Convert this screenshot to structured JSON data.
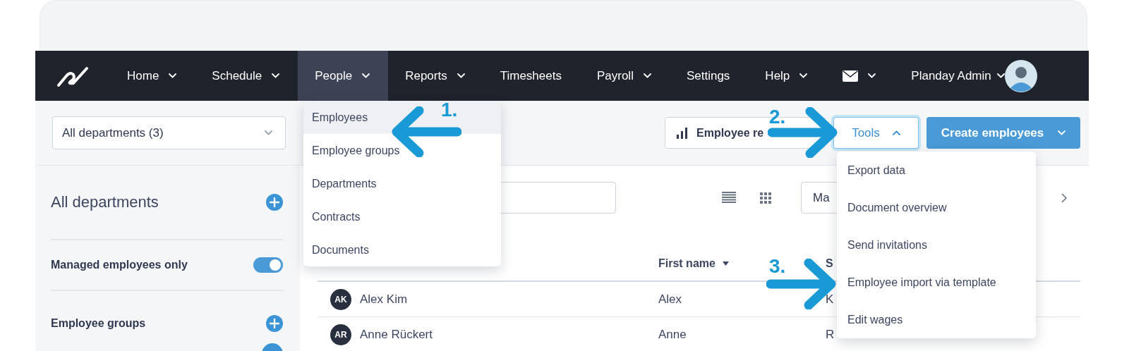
{
  "top_nav": {
    "items": [
      {
        "kind": "link",
        "label": "Home",
        "dropdown": true,
        "selected": false
      },
      {
        "kind": "link",
        "label": "Schedule",
        "dropdown": true,
        "selected": false
      },
      {
        "kind": "link",
        "label": "People",
        "dropdown": true,
        "selected": true
      },
      {
        "kind": "link",
        "label": "Reports",
        "dropdown": true,
        "selected": false
      },
      {
        "kind": "link",
        "label": "Timesheets",
        "dropdown": false,
        "selected": false
      },
      {
        "kind": "link",
        "label": "Payroll",
        "dropdown": true,
        "selected": false
      },
      {
        "kind": "link",
        "label": "Settings",
        "dropdown": false,
        "selected": false
      },
      {
        "kind": "link",
        "label": "Help",
        "dropdown": true,
        "selected": false
      },
      {
        "kind": "mail",
        "dropdown": true,
        "selected": false
      },
      {
        "kind": "user",
        "label": "Planday Admin",
        "dropdown": true,
        "selected": false
      }
    ]
  },
  "toolbar": {
    "department_select": "All departments (3)",
    "buttons": [
      {
        "kind": "report",
        "label": "Employee re"
      },
      {
        "kind": "menu",
        "label": "Tools",
        "expanded": true
      },
      {
        "kind": "primary",
        "label": "Create employees"
      }
    ]
  },
  "people_menu": {
    "items": [
      {
        "label": "Employees",
        "selected": true
      },
      {
        "label": "Employee groups",
        "selected": false
      },
      {
        "label": "Departments",
        "selected": false
      },
      {
        "label": "Contracts",
        "selected": false
      },
      {
        "label": "Documents",
        "selected": false
      }
    ]
  },
  "tools_menu": {
    "items": [
      "Export data",
      "Document overview",
      "Send invitations",
      "Employee import via template",
      "Edit wages"
    ]
  },
  "sidebar": {
    "title": "All departments",
    "toggle": {
      "label": "Managed employees only",
      "on": true
    },
    "sections": [
      "Employee groups"
    ]
  },
  "period_select": {
    "value": "Ma"
  },
  "table": {
    "columns": [
      {
        "label": "First name",
        "sorted": true
      },
      {
        "label": "S",
        "sorted": false
      }
    ],
    "rows": [
      {
        "initials": "AK",
        "name": "Alex Kim",
        "first_name": "Alex",
        "column_3": "K"
      },
      {
        "initials": "AR",
        "name": "Anne Rückert",
        "first_name": "Anne",
        "column_3": "R"
      }
    ]
  },
  "annotations": [
    {
      "label": "1.",
      "kind": "arrow_left"
    },
    {
      "label": "2.",
      "kind": "arrow_right"
    },
    {
      "label": "3.",
      "kind": "arrow_right"
    }
  ]
}
